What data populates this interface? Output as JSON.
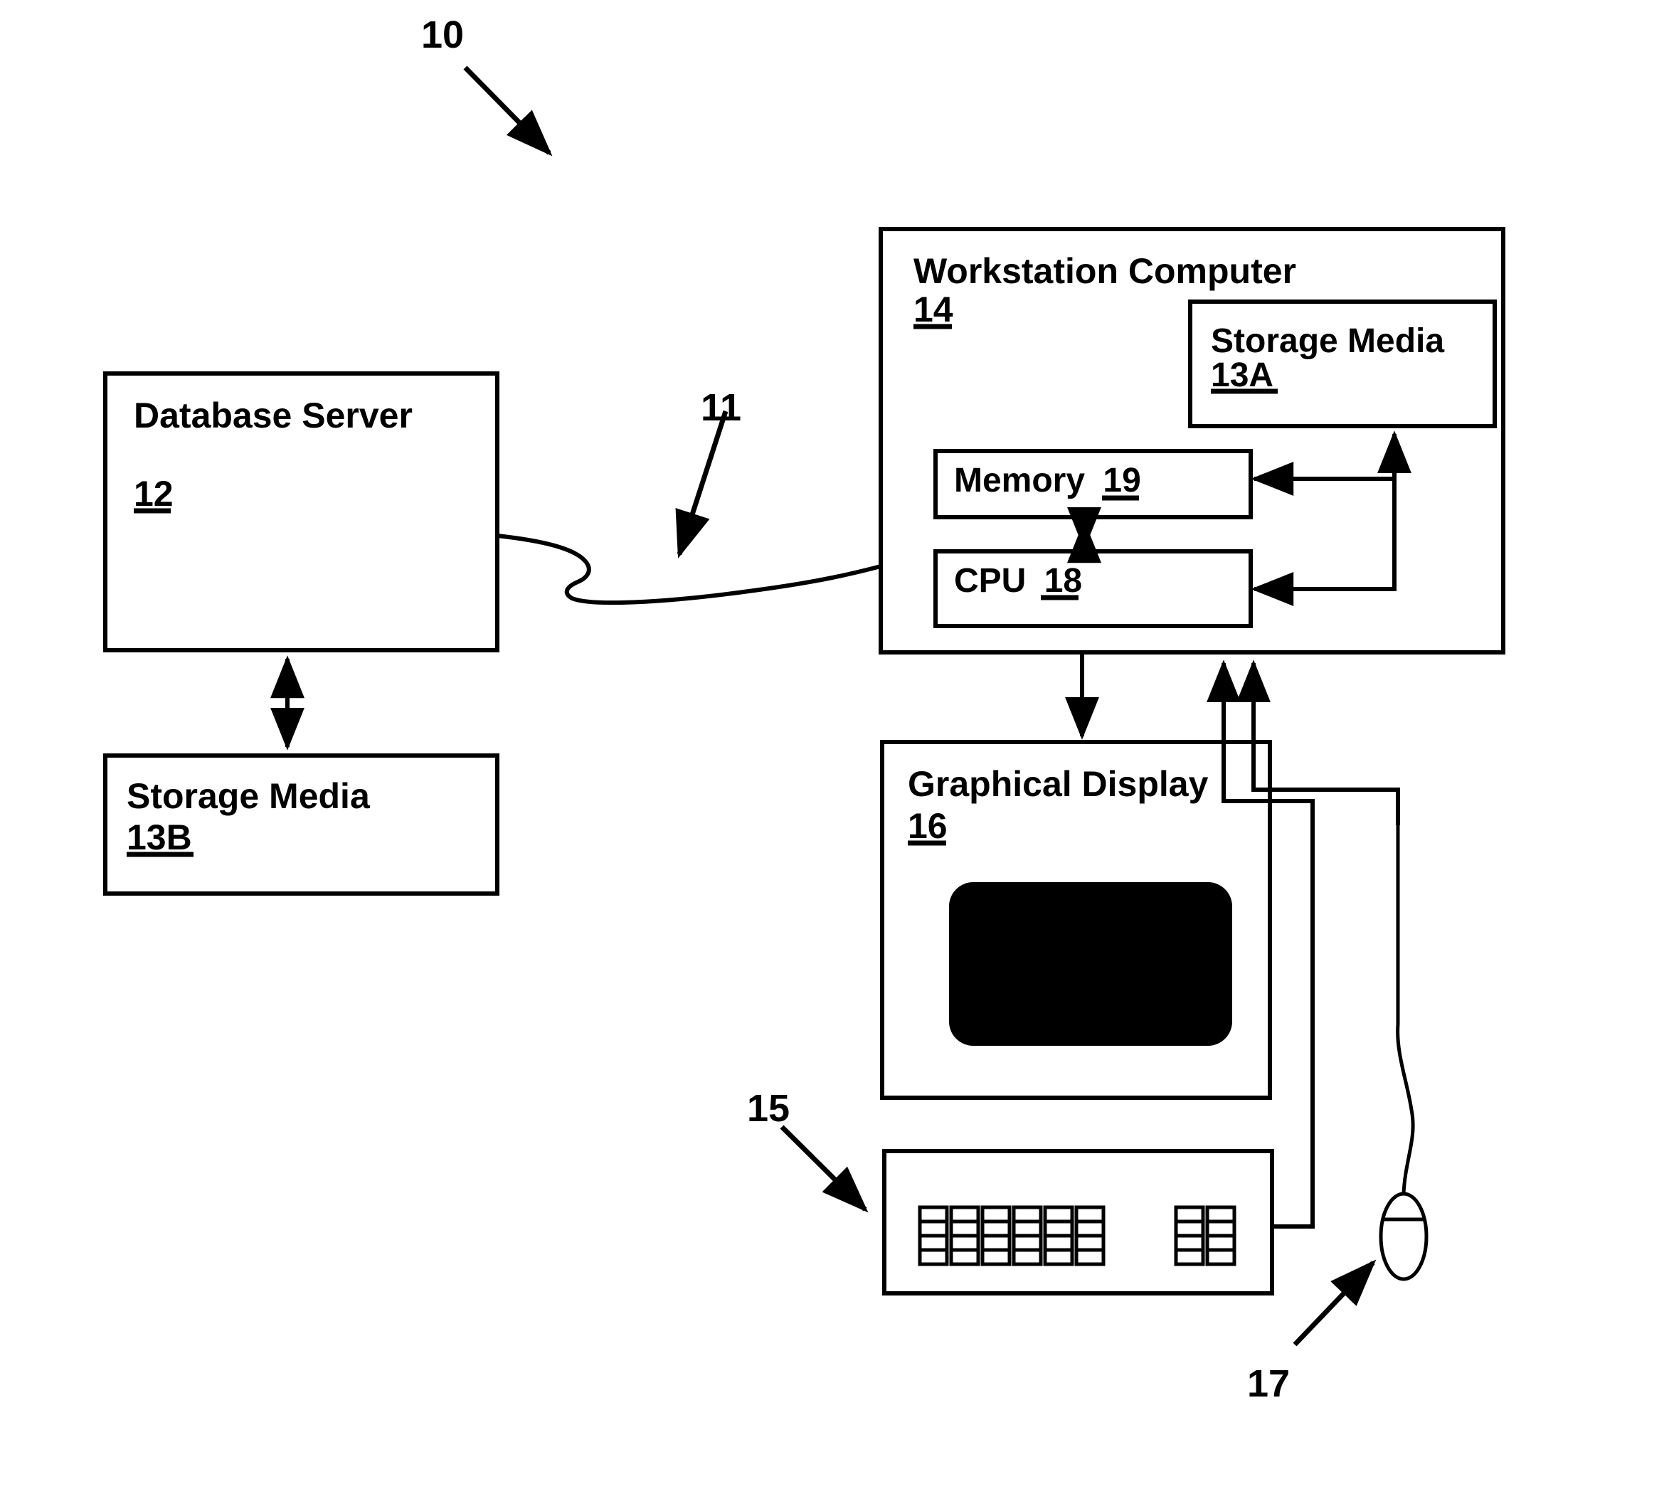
{
  "figure": {
    "system_label": "10",
    "network_label": "11",
    "keyboard_label": "15",
    "mouse_label": "17"
  },
  "nodes": {
    "database_server": {
      "title": "Database Server",
      "ref": "12"
    },
    "storage_media_b": {
      "title": "Storage Media",
      "ref": "13B"
    },
    "workstation": {
      "title": "Workstation Computer",
      "ref": "14"
    },
    "storage_media_a": {
      "title": "Storage Media",
      "ref": "13A"
    },
    "memory": {
      "title": "Memory",
      "ref": "19"
    },
    "cpu": {
      "title": "CPU",
      "ref": "18"
    },
    "graphical_display": {
      "title": "Graphical Display",
      "ref": "16"
    }
  },
  "colors": {
    "ink": "#000000",
    "paper": "#ffffff",
    "screen": "#000000"
  }
}
